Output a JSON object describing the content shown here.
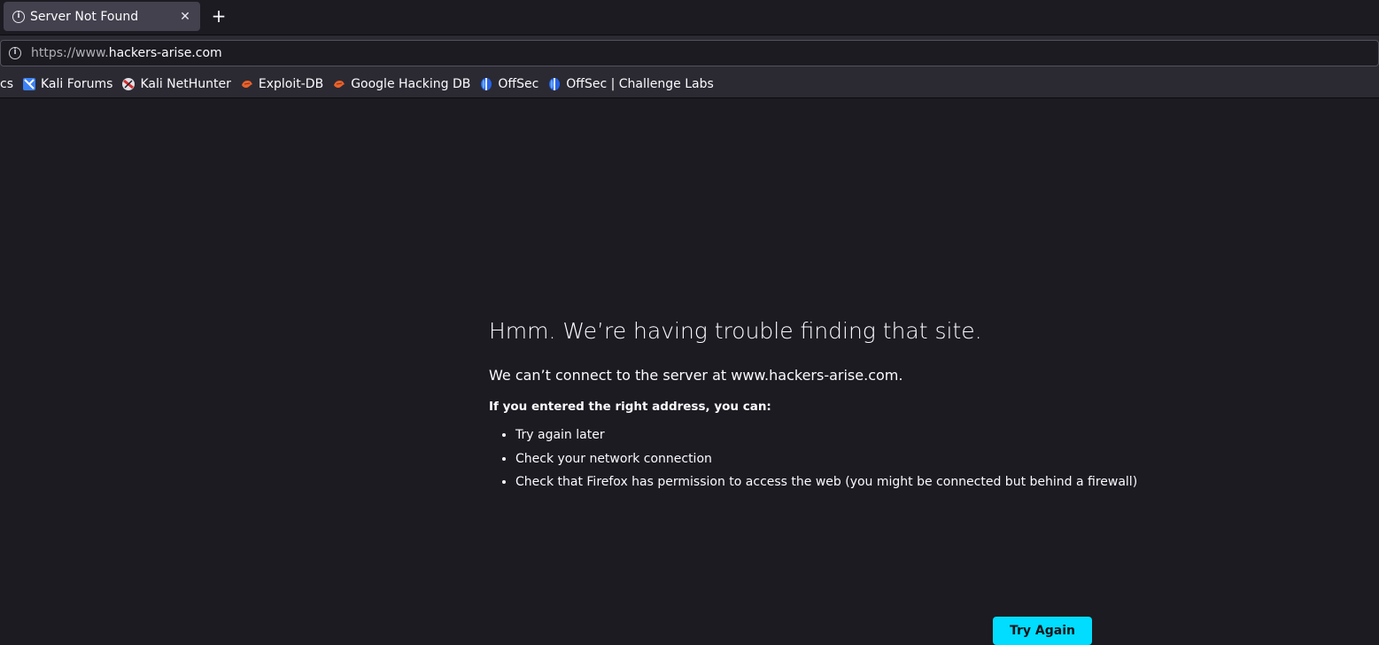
{
  "tab": {
    "title": "Server Not Found",
    "close_glyph": "✕",
    "new_tab_glyph": "+"
  },
  "urlbar": {
    "prefix": "https://www.",
    "domain": "hackers-arise.com"
  },
  "bookmarks": {
    "partial_label": "cs",
    "items": [
      {
        "label": "Kali Forums",
        "icon": "kali-forums-icon"
      },
      {
        "label": "Kali NetHunter",
        "icon": "kali-nethunter-icon"
      },
      {
        "label": "Exploit-DB",
        "icon": "exploit-db-icon"
      },
      {
        "label": "Google Hacking DB",
        "icon": "google-hacking-db-icon"
      },
      {
        "label": "OffSec",
        "icon": "offsec-icon"
      },
      {
        "label": "OffSec | Challenge Labs",
        "icon": "offsec-icon"
      }
    ]
  },
  "error": {
    "title": "Hmm. We’re having trouble finding that site.",
    "description": "We can’t connect to the server at www.hackers-arise.com.",
    "subtitle": "If you entered the right address, you can:",
    "suggestions": [
      "Try again later",
      "Check your network connection",
      "Check that Firefox has permission to access the web (you might be connected but behind a firewall)"
    ],
    "button_label": "Try Again"
  },
  "colors": {
    "accent": "#00ddff",
    "background": "#1c1b22",
    "toolbar": "#2b2a33"
  }
}
